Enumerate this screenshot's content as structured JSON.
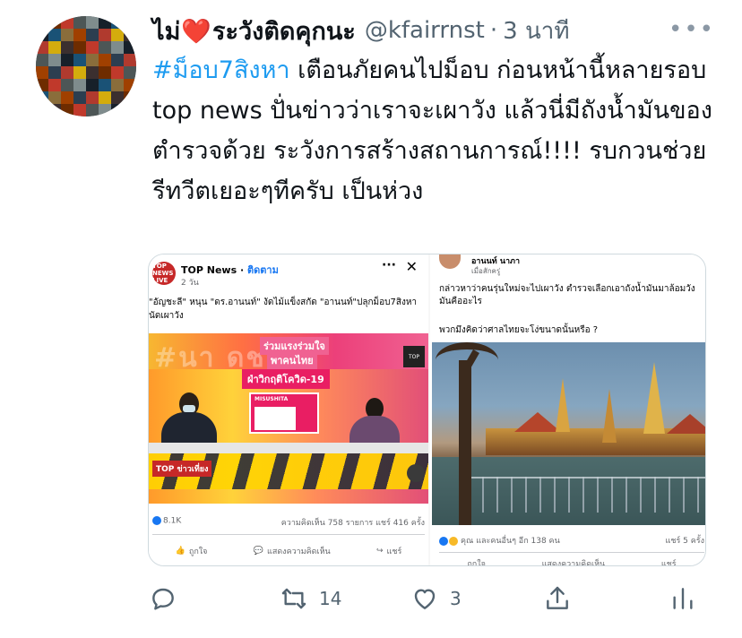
{
  "tweet": {
    "display_name_part1": "ไม่",
    "heart_emoji": "❤️",
    "display_name_part2": "ระวังติดคุกนะ",
    "handle": "@kfairrnst",
    "separator": "·",
    "time": "3 นาที",
    "more": "•••",
    "hashtag": "#ม็อบ7สิงหา",
    "text": " เตือนภัยคนไปม็อบ ก่อนหน้านี้หลายรอบ top news ปั่นข่าวว่าเราจะเผาวัง แล้วนี่มีถังน้ำมันของตำรวจด้วย ระวังการสร้างสถานการณ์!!!! รบกวนช่วยรีทวีตเยอะๆทีครับ เป็นห่วง"
  },
  "media_left": {
    "page_name": "TOP News",
    "follow_label": "ติดตาม",
    "post_time": "2 วัน",
    "logo_text": "TOP NEWS LIVE",
    "post_text": "\"อัญชะลี\" หนุน \"ดร.อานนท์\" งัดไม้แข็งสกัด \"อานนท์\"ปลุกม็อบ7สิงหานัดเผาวัง",
    "tv_banner_1": "ร่วมแรงร่วมใจ",
    "tv_banner_2": "พาคนไทย",
    "tv_banner_3": "ฝ่าวิกฤติโควิด-19",
    "tv_card": "MISUSHITA",
    "tv_logo": "TOP ข่าวเที่ยง",
    "likes": "8.1K",
    "comments_shares": "ความคิดเห็น 758 รายการ  แชร์ 416 ครั้ง",
    "action_like": "ถูกใจ",
    "action_comment": "แสดงความคิดเห็น",
    "action_share": "แชร์"
  },
  "media_right": {
    "name": "อานนท์ นาภา",
    "sub": "เมื่อสักครู่",
    "text1": "กล่าวหาว่าคนรุ่นใหม่จะไปเผาวัง ตำรวจเลือกเอาถังน้ำมันมาล้อมวัง มันคืออะไร",
    "text2": "พวกมึงคิดว่าศาลไทยจะโง่ขนาดนั้นหรือ ?",
    "reactions": "คุณ และคนอื่นๆ อีก 138 คน",
    "shares": "แชร์ 5 ครั้ง",
    "action_like": "ถูกใจ",
    "action_comment": "แสดงความคิดเห็น",
    "action_share": "แชร์"
  },
  "actions": {
    "reply_icon": "reply-icon",
    "retweet_icon": "retweet-icon",
    "retweet_count": "14",
    "like_icon": "like-icon",
    "like_count": "3",
    "share_icon": "share-icon",
    "analytics_icon": "analytics-icon"
  },
  "colors": {
    "hashtag": "#1d9bf0",
    "secondary_text": "#536471",
    "facebook_blue": "#1877f2"
  }
}
